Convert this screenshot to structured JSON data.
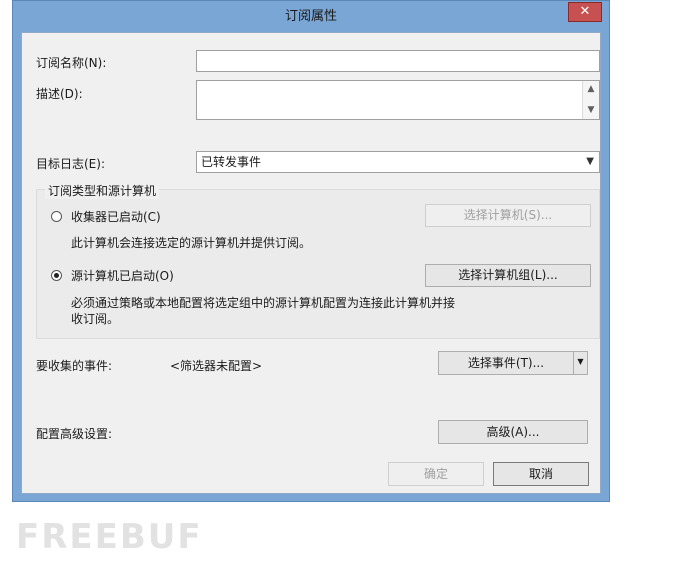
{
  "window": {
    "title": "订阅属性",
    "close_glyph": "✕"
  },
  "form": {
    "name_label": "订阅名称(N):",
    "name_value": "",
    "desc_label": "描述(D):",
    "desc_value": "",
    "target_log_label": "目标日志(E):",
    "target_log_value": "已转发事件"
  },
  "group": {
    "title": "订阅类型和源计算机",
    "collector": {
      "label": "收集器已启动(C)",
      "selected": false,
      "button": "选择计算机(S)...",
      "description": "此计算机会连接选定的源计算机并提供订阅。"
    },
    "source": {
      "label": "源计算机已启动(O)",
      "selected": true,
      "button": "选择计算机组(L)...",
      "description_line1": "必须通过策略或本地配置将选定组中的源计算机配置为连接此计算机并接",
      "description_line2": "收订阅。"
    }
  },
  "events": {
    "label": "要收集的事件:",
    "value": "<筛选器未配置>",
    "button": "选择事件(T)..."
  },
  "advanced": {
    "label": "配置高级设置:",
    "button": "高级(A)..."
  },
  "footer": {
    "ok": "确定",
    "cancel": "取消"
  },
  "watermark": "FREEBUF"
}
